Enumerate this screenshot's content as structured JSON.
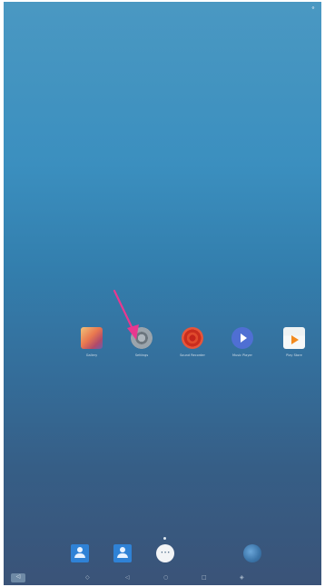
{
  "status": {
    "corner_icon": "settings-dot"
  },
  "apps": [
    {
      "label": "Gallery",
      "icon": "gallery-icon"
    },
    {
      "label": "Settings",
      "icon": "settings-icon"
    },
    {
      "label": "Sound Recorder",
      "icon": "sound-recorder-icon"
    },
    {
      "label": "Music Player",
      "icon": "music-player-icon"
    },
    {
      "label": "Play Store",
      "icon": "play-store-icon"
    }
  ],
  "annotation": {
    "type": "arrow",
    "color": "#e8388f",
    "target": "Settings"
  },
  "dock": [
    {
      "icon": "contacts-icon"
    },
    {
      "icon": "contacts-icon"
    },
    {
      "icon": "all-apps-icon"
    },
    {
      "icon": "browser-globe-icon"
    }
  ],
  "nav": {
    "back": "◁",
    "items": [
      "◇",
      "◁",
      "○",
      "□",
      "◈"
    ]
  },
  "colors": {
    "wallpaper_top": "#4a98c2",
    "wallpaper_bottom": "#3a5378",
    "arrow": "#e8388f"
  }
}
